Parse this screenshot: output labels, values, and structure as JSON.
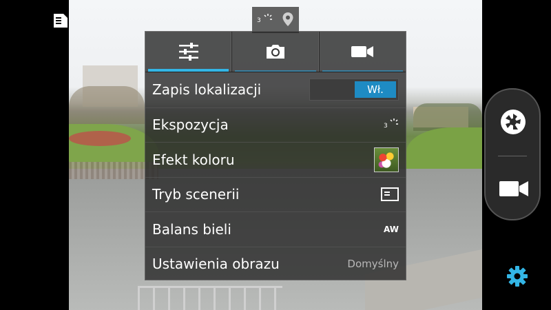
{
  "top_indicator": {
    "timer_number": "3"
  },
  "settings_popup": {
    "tabs": [
      {
        "icon": "sliders-icon",
        "active": true
      },
      {
        "icon": "camera-icon",
        "active": false
      },
      {
        "icon": "video-camera-icon",
        "active": false
      }
    ],
    "rows": [
      {
        "label": "Zapis lokalizacji",
        "value": "Wł."
      },
      {
        "label": "Ekspozycja",
        "value_icon": "exposure-icon",
        "value_number": "3"
      },
      {
        "label": "Efekt koloru",
        "value_icon": "flower-thumbnail"
      },
      {
        "label": "Tryb scenerii",
        "value_icon": "scene-icon"
      },
      {
        "label": "Balans bieli",
        "value_icon": "auto-white-balance-icon",
        "value_text": "AW"
      },
      {
        "label": "Ustawienia obrazu",
        "value": "Domyślny"
      }
    ]
  },
  "right_panel": {
    "shutter_icon": "shutter-icon",
    "video_icon": "video-camera-icon",
    "settings_icon": "gear-icon"
  },
  "colors": {
    "accent": "#33b5e5",
    "toggle_on": "#1e8bc3",
    "gear": "#33b5e5"
  }
}
